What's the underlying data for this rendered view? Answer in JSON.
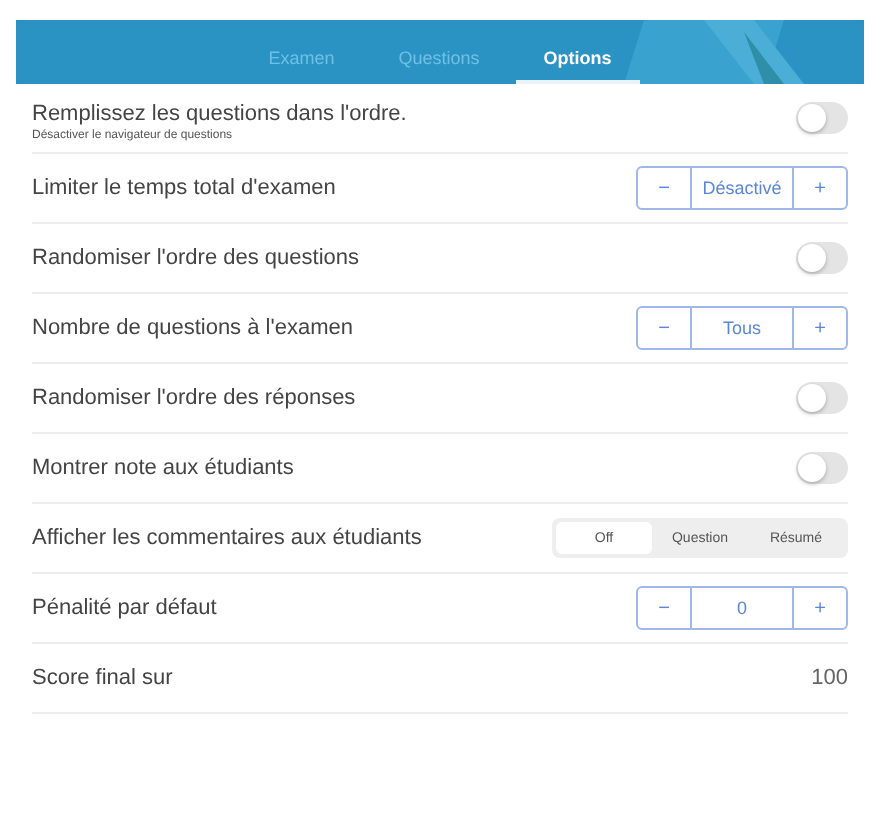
{
  "tabs": [
    {
      "label": "Examen",
      "selected": false
    },
    {
      "label": "Questions",
      "selected": false
    },
    {
      "label": "Options",
      "selected": true
    }
  ],
  "settings": [
    {
      "kind": "toggle",
      "label": "Remplissez les questions dans l'ordre.",
      "hint": "Désactiver le navigateur de questions",
      "on": false
    },
    {
      "kind": "stepper",
      "label": "Limiter le temps total d'examen",
      "value": "Désactivé",
      "minus": "−",
      "plus": "+"
    },
    {
      "kind": "toggle",
      "label": "Randomiser l'ordre des questions",
      "on": false
    },
    {
      "kind": "stepper",
      "label": "Nombre de questions à l'examen",
      "value": "Tous",
      "minus": "−",
      "plus": "+"
    },
    {
      "kind": "toggle",
      "label": "Randomiser l'ordre des réponses",
      "on": false
    },
    {
      "kind": "toggle",
      "label": "Montrer note aux étudiants",
      "on": false
    },
    {
      "kind": "segmented",
      "label": "Afficher les commentaires aux étudiants",
      "options": [
        {
          "label": "Off",
          "selected": true
        },
        {
          "label": "Question",
          "selected": false
        },
        {
          "label": "Résumé",
          "selected": false
        }
      ]
    },
    {
      "kind": "stepper",
      "label": "Pénalité par défaut",
      "value": "0",
      "minus": "−",
      "plus": "+"
    },
    {
      "kind": "value",
      "label": "Score final sur",
      "value": "100"
    }
  ]
}
